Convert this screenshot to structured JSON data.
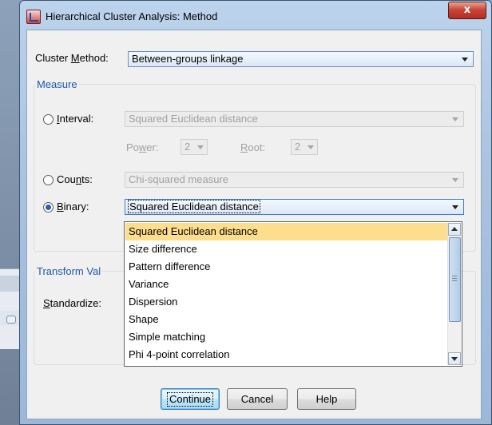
{
  "window": {
    "title": "Hierarchical Cluster Analysis: Method",
    "close_glyph": "x"
  },
  "cluster_method": {
    "label_pre": "Cluster ",
    "label_mnemonic": "M",
    "label_post": "ethod:",
    "value": "Between-groups linkage"
  },
  "measure": {
    "title": "Measure",
    "interval": {
      "label_mnemonic": "I",
      "label_post": "nterval:",
      "value": "Squared Euclidean distance",
      "power_label_pre": "Po",
      "power_label_mnemonic": "w",
      "power_label_post": "er:",
      "power_value": "2",
      "root_label_mnemonic": "R",
      "root_label_post": "oot:",
      "root_value": "2"
    },
    "counts": {
      "label_pre": "Cou",
      "label_mnemonic": "n",
      "label_post": "ts:",
      "value": "Chi-squared measure"
    },
    "binary": {
      "label_mnemonic": "B",
      "label_post": "inary:",
      "value": "Squared Euclidean distance"
    }
  },
  "dropdown": {
    "items": [
      "Squared Euclidean distance",
      "Size difference",
      "Pattern difference",
      "Variance",
      "Dispersion",
      "Shape",
      "Simple matching",
      "Phi 4-point correlation"
    ],
    "selected_index": 0
  },
  "transform": {
    "title": "Transform Val",
    "standardize_mnemonic": "S",
    "standardize_post": "tandardize:"
  },
  "buttons": {
    "continue": "Continue",
    "cancel": "Cancel",
    "help": "Help"
  }
}
